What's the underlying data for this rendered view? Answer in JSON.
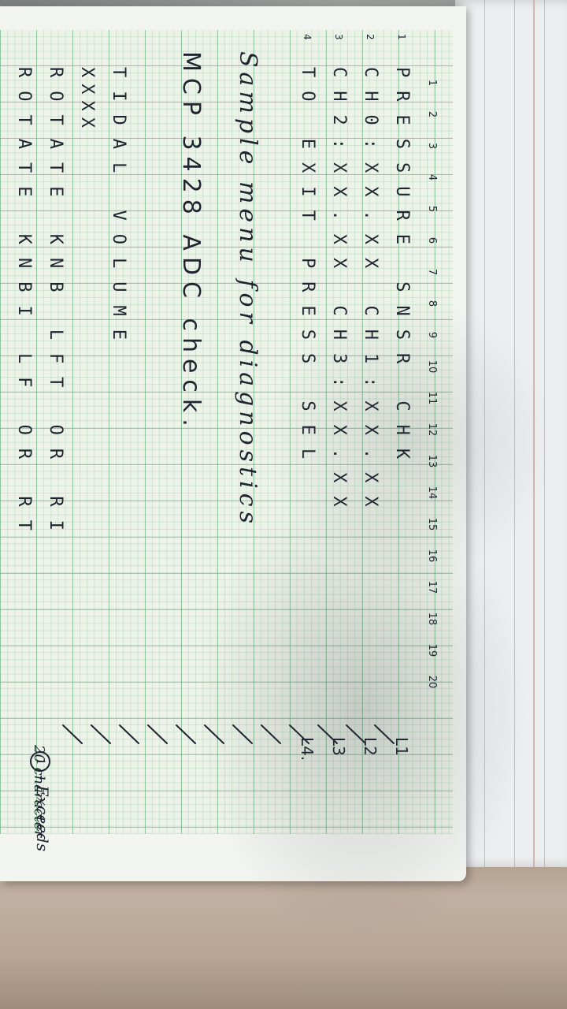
{
  "column_numbers": [
    "1",
    "2",
    "3",
    "4",
    "5",
    "6",
    "7",
    "8",
    "9",
    "10",
    "11",
    "12",
    "13",
    "14",
    "15",
    "16",
    "17",
    "18",
    "19",
    "20"
  ],
  "rows": [
    {
      "num": "1",
      "text": "PRESSURE SNSR CHK",
      "label": "L1"
    },
    {
      "num": "2",
      "text": "CH0:XX.XX CH1:XX.XX",
      "label": "L2"
    },
    {
      "num": "3",
      "text": "CH2:XX.XX CH3:XX.XX",
      "label": "L3"
    },
    {
      "num": "4",
      "text": "TO EXIT PRESS SEL",
      "label": "L4."
    }
  ],
  "sample_heading": "Sample menu for diagnostics",
  "mcp_heading": "MCP 3428 ADC check.",
  "extra_lines": [
    {
      "text": "TIDAL VOLUME"
    },
    {
      "text": "XXXX"
    },
    {
      "text": "ROTATE KNB LFT OR RI"
    },
    {
      "text": "ROTATE KNBI LF OR RT"
    }
  ],
  "note": {
    "marker": "1",
    "line1": "- Exceeds",
    "line2": "20 character"
  },
  "colors": {
    "ink": "#1f2430",
    "grid": "#5faa78",
    "paper": "#eef3ea"
  }
}
